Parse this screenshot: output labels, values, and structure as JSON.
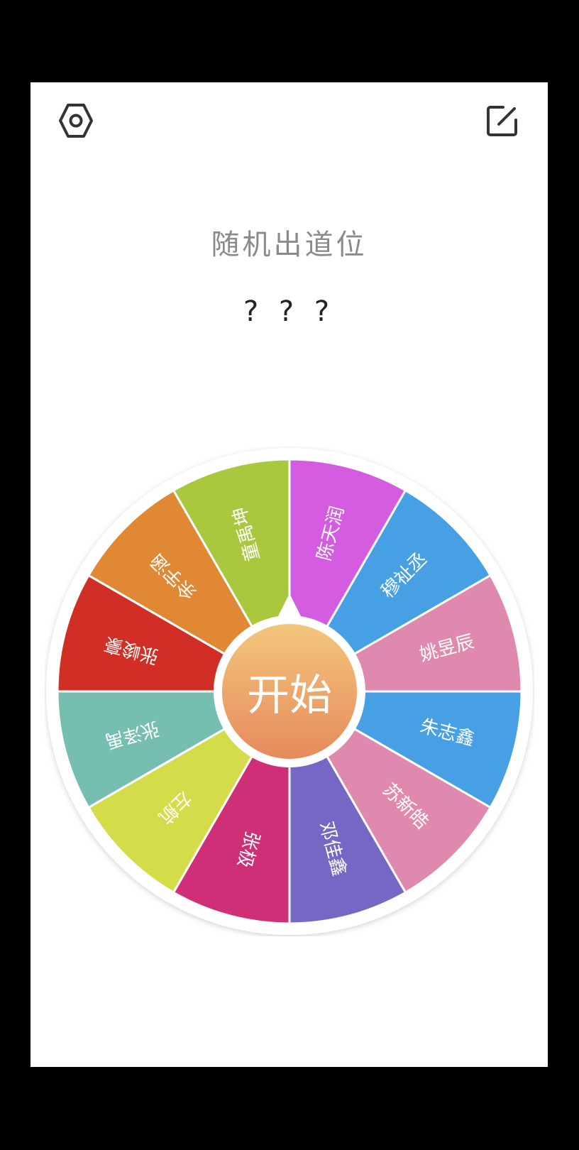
{
  "header": {
    "settings_icon": "settings-hex-icon",
    "edit_icon": "edit-square-icon"
  },
  "title": "随机出道位",
  "result": "? ? ?",
  "wheel": {
    "start_label": "开始",
    "segments": [
      {
        "label": "陈天润",
        "color": "#d45ce0"
      },
      {
        "label": "穆祉丞",
        "color": "#46a0e3"
      },
      {
        "label": "姚昱辰",
        "color": "#e089ae"
      },
      {
        "label": "朱志鑫",
        "color": "#46a0e3"
      },
      {
        "label": "苏新皓",
        "color": "#e089ae"
      },
      {
        "label": "邓佳鑫",
        "color": "#7767c5"
      },
      {
        "label": "张极",
        "color": "#cf2f77"
      },
      {
        "label": "左航",
        "color": "#d4dc4a"
      },
      {
        "label": "张泽禹",
        "color": "#76beb0"
      },
      {
        "label": "张峻豪",
        "color": "#d12e26"
      },
      {
        "label": "余宇涵",
        "color": "#e08834"
      },
      {
        "label": "童禹坤",
        "color": "#a9c83e"
      }
    ]
  }
}
